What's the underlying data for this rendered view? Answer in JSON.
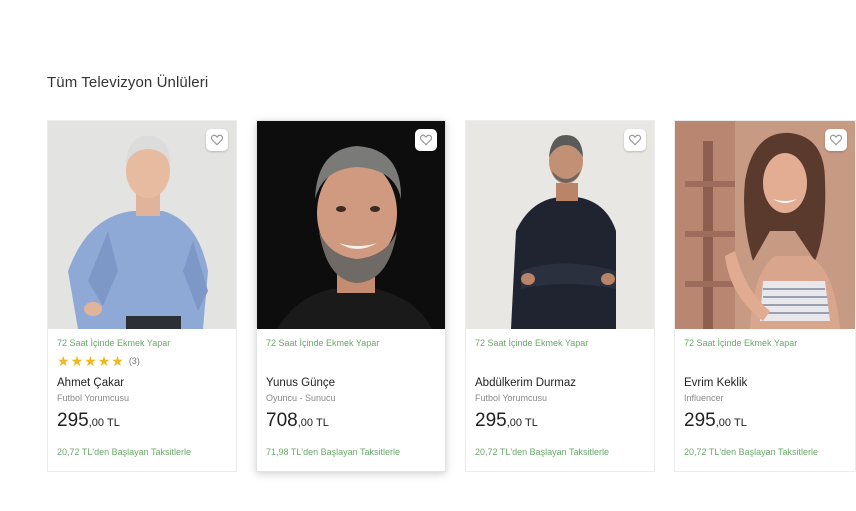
{
  "section": {
    "title": "Tüm Televizyon Ünlüleri"
  },
  "colors": {
    "accent_green": "#6aa86a",
    "star": "#f2b71b"
  },
  "cards": [
    {
      "delivery": "72 Saat İçinde Ekmek Yapar",
      "rating": {
        "stars": 5,
        "count": "(3)"
      },
      "name": "Ahmet Çakar",
      "job": "Futbol Yorumcusu",
      "price_int": "295",
      "price_dec": ",00",
      "currency": "TL",
      "sales": "20,72 TL'den Başlayan Taksitlerle",
      "favorite_icon": "heart-icon"
    },
    {
      "delivery": "72 Saat İçinde Ekmek Yapar",
      "name": "Yunus Günçe",
      "job": "Oyuncu - Sunucu",
      "price_int": "708",
      "price_dec": ",00",
      "currency": "TL",
      "sales": "71,98 TL'den Başlayan Taksitlerle",
      "favorite_icon": "heart-icon"
    },
    {
      "delivery": "72 Saat İçinde Ekmek Yapar",
      "name": "Abdülkerim Durmaz",
      "job": "Futbol Yorumcusu",
      "price_int": "295",
      "price_dec": ",00",
      "currency": "TL",
      "sales": "20,72 TL'den Başlayan Taksitlerle",
      "favorite_icon": "heart-icon"
    },
    {
      "delivery": "72 Saat İçinde Ekmek Yapar",
      "name": "Evrim Keklik",
      "job": "Influencer",
      "price_int": "295",
      "price_dec": ",00",
      "currency": "TL",
      "sales": "20,72 TL'den Başlayan Taksitlerle",
      "favorite_icon": "heart-icon"
    }
  ]
}
